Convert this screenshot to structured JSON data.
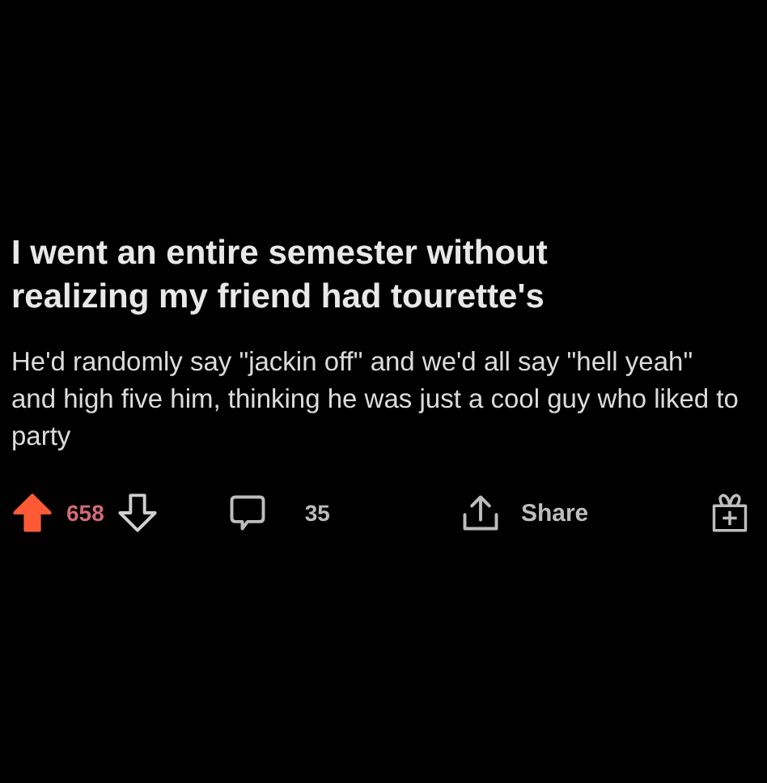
{
  "post": {
    "title": "I went an entire semester without realizing my friend had tourette's",
    "body": "He'd randomly say \"jackin off\" and we'd all say \"hell yeah\" and high five him, thinking he was just a cool guy who liked to party"
  },
  "actions": {
    "upvoted": true,
    "score": "658",
    "comments": "35",
    "share": "Share"
  }
}
